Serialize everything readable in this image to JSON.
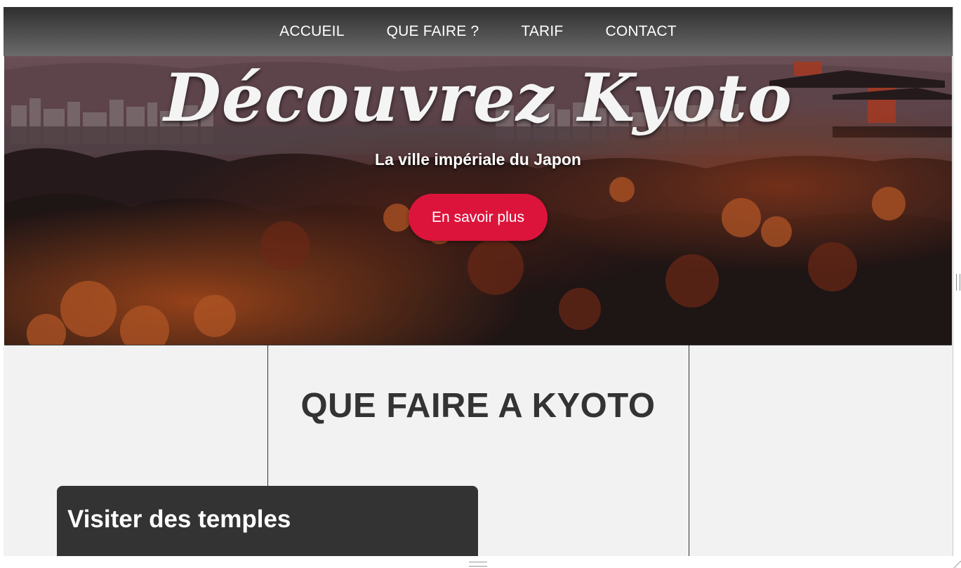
{
  "nav": {
    "items": [
      {
        "label": "ACCUEIL"
      },
      {
        "label": "QUE FAIRE ?"
      },
      {
        "label": "TARIF"
      },
      {
        "label": "CONTACT"
      }
    ]
  },
  "hero": {
    "title": "Découvrez Kyoto",
    "subtitle": "La ville impériale du Japon",
    "cta_label": "En savoir plus",
    "cta_color": "#dc143c"
  },
  "section": {
    "title": "QUE FAIRE A KYOTO"
  },
  "card": {
    "title": "Visiter des temples"
  },
  "colors": {
    "page_bg": "#f2f2f2",
    "card_bg": "#333333",
    "heading": "#333333"
  }
}
